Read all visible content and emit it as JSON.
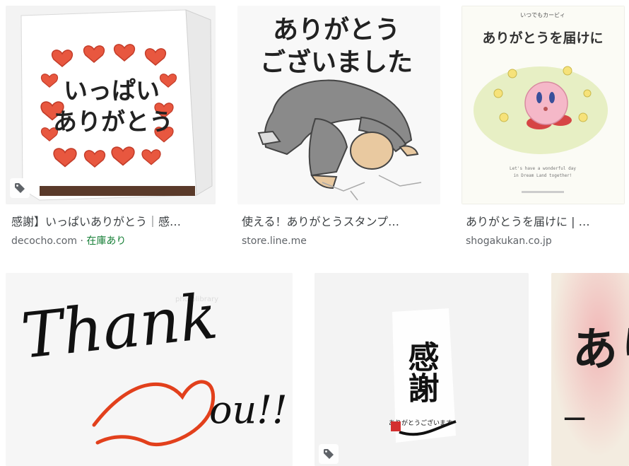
{
  "results": [
    {
      "title": "感謝】いっぱいありがとう｜感…",
      "source": "decocho.com",
      "separator": " · ",
      "stock": "在庫あり",
      "image_text": [
        "いっぱい",
        "ありがとう"
      ]
    },
    {
      "title": "使える！ありがとうスタンプ…",
      "source": "store.line.me",
      "image_text": [
        "ありがとう",
        "ございました"
      ]
    },
    {
      "title": "ありがとうを届けに | …",
      "source": "shogakukan.co.jp",
      "image_text": [
        "ありがとうを届けに",
        "いつでもカービィ",
        "Let's have a wonderful day",
        "in Dream Land together!"
      ]
    },
    {
      "image_text": [
        "Thank",
        "ou!!",
        "photolibrary"
      ]
    },
    {
      "image_text": [
        "感謝",
        "ありがとうございます"
      ]
    },
    {
      "image_text": [
        "あり",
        "一"
      ]
    }
  ],
  "icons": {
    "tag": "tag-icon",
    "hearts": "heart-icon"
  },
  "colors": {
    "stock_green": "#188038",
    "source_gray": "#5f6368",
    "title_gray": "#3c4043",
    "heart_red": "#e8573f"
  }
}
